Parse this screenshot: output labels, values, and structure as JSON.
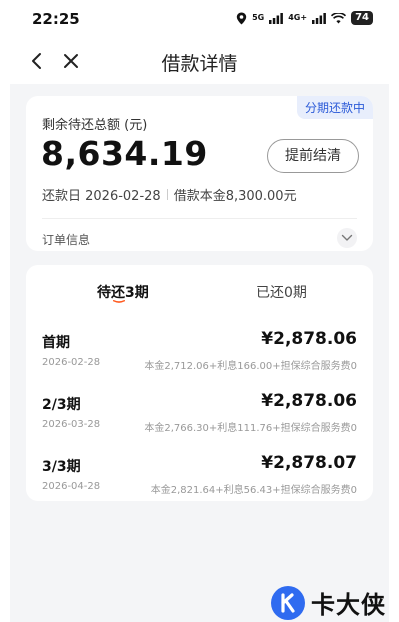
{
  "status_bar": {
    "time": "22:25",
    "signal1": "5G",
    "signal2": "4G+",
    "battery": "74"
  },
  "nav": {
    "title": "借款详情"
  },
  "summary": {
    "status_tag": "分期还款中",
    "remain_label": "剩余待还总额 (元)",
    "remain_amount": "8,634.19",
    "prepay_button": "提前结清",
    "repay_day": "还款日 2026-02-28",
    "principal": "借款本金8,300.00元",
    "order_info": "订单信息"
  },
  "tabs": {
    "pending": "待还3期",
    "paid": "已还0期"
  },
  "periods": [
    {
      "name": "首期",
      "amount": "¥2,878.06",
      "date": "2026-02-28",
      "detail": "本金2,712.06+利息166.00+担保综合服务费0"
    },
    {
      "name": "2/3期",
      "amount": "¥2,878.06",
      "date": "2026-03-28",
      "detail": "本金2,766.30+利息111.76+担保综合服务费0"
    },
    {
      "name": "3/3期",
      "amount": "¥2,878.07",
      "date": "2026-04-28",
      "detail": "本金2,821.64+利息56.43+担保综合服务费0"
    }
  ],
  "watermark": {
    "text": "卡大侠",
    "logo_letter": "K"
  },
  "colors": {
    "accent": "#2c5bd8",
    "tab_underline": "#ff5a1f",
    "logo": "#2f6bf0"
  }
}
